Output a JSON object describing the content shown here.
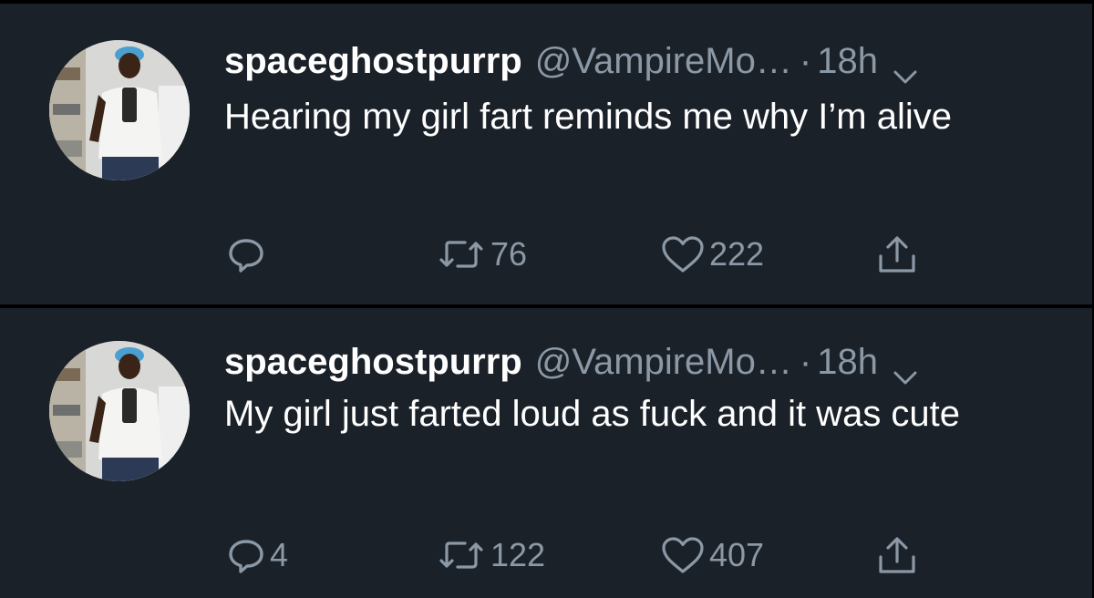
{
  "colors": {
    "background": "#1b2129",
    "separator": "#000000",
    "name": "#ffffff",
    "muted": "#8b98a5",
    "text": "#ffffff"
  },
  "tweets": [
    {
      "name": "spaceghostpurrp",
      "handle": "@VampireMo…",
      "dot": "·",
      "time": "18h",
      "text": "Hearing my girl fart reminds me why I’m alive",
      "reply_count": "",
      "retweet_count": "76",
      "like_count": "222",
      "icons": [
        "avatar-photo",
        "chevron-down-icon",
        "reply-icon",
        "retweet-icon",
        "heart-icon",
        "share-icon"
      ]
    },
    {
      "name": "spaceghostpurrp",
      "handle": "@VampireMo…",
      "dot": "·",
      "time": "18h",
      "text": "My girl just farted loud as fuck and it was cute",
      "reply_count": "4",
      "retweet_count": "122",
      "like_count": "407",
      "icons": [
        "avatar-photo",
        "chevron-down-icon",
        "reply-icon",
        "retweet-icon",
        "heart-icon",
        "share-icon"
      ]
    }
  ]
}
